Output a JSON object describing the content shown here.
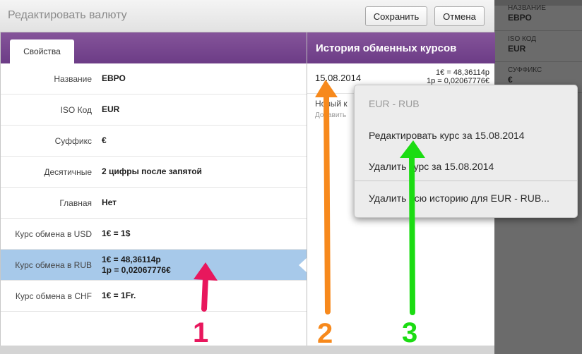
{
  "dialog": {
    "title": "Редактировать валюту",
    "save_label": "Сохранить",
    "cancel_label": "Отмена"
  },
  "tabs": [
    {
      "label": "Свойства",
      "active": true
    }
  ],
  "properties": [
    {
      "label": "Название",
      "value": "ЕВРО"
    },
    {
      "label": "ISO Код",
      "value": "EUR"
    },
    {
      "label": "Суффикс",
      "value": "€"
    },
    {
      "label": "Десятичные",
      "value": "2 цифры после запятой"
    },
    {
      "label": "Главная",
      "value": "Нет"
    },
    {
      "label": "Курс обмена в USD",
      "value": "1€ = 1$"
    },
    {
      "label": "Курс обмена в RUB",
      "value": "1€ = 48,36114р",
      "value2": "1р = 0,02067776€",
      "selected": true
    },
    {
      "label": "Курс обмена в CHF",
      "value": "1€ = 1Fr."
    }
  ],
  "history": {
    "title": "История обменных курсов",
    "rows": [
      {
        "date": "15.08.2014",
        "rate1": "1€ = 48,36114р",
        "rate2": "1р = 0,02067776€"
      }
    ],
    "new_rate_label": "Новый к",
    "add_label": "Добавить"
  },
  "context_menu": {
    "header": "EUR - RUB",
    "items": [
      "Редактировать курс за 15.08.2014",
      "Удалить курс за 15.08.2014",
      "Удалить всю историю для EUR - RUB..."
    ]
  },
  "background_panel": {
    "fields": [
      {
        "label": "НАЗВАНИЕ",
        "value": "ЕВРО"
      },
      {
        "label": "ISO КОД",
        "value": "EUR"
      },
      {
        "label": "СУФФИКС",
        "value": "€"
      }
    ]
  },
  "annotations": [
    {
      "number": "1",
      "color": "#e8175d"
    },
    {
      "number": "2",
      "color": "#f7891c"
    },
    {
      "number": "3",
      "color": "#1bdc12"
    }
  ],
  "colors": {
    "header_purple": "#7a4792",
    "selected_row": "#a7c9ea"
  }
}
